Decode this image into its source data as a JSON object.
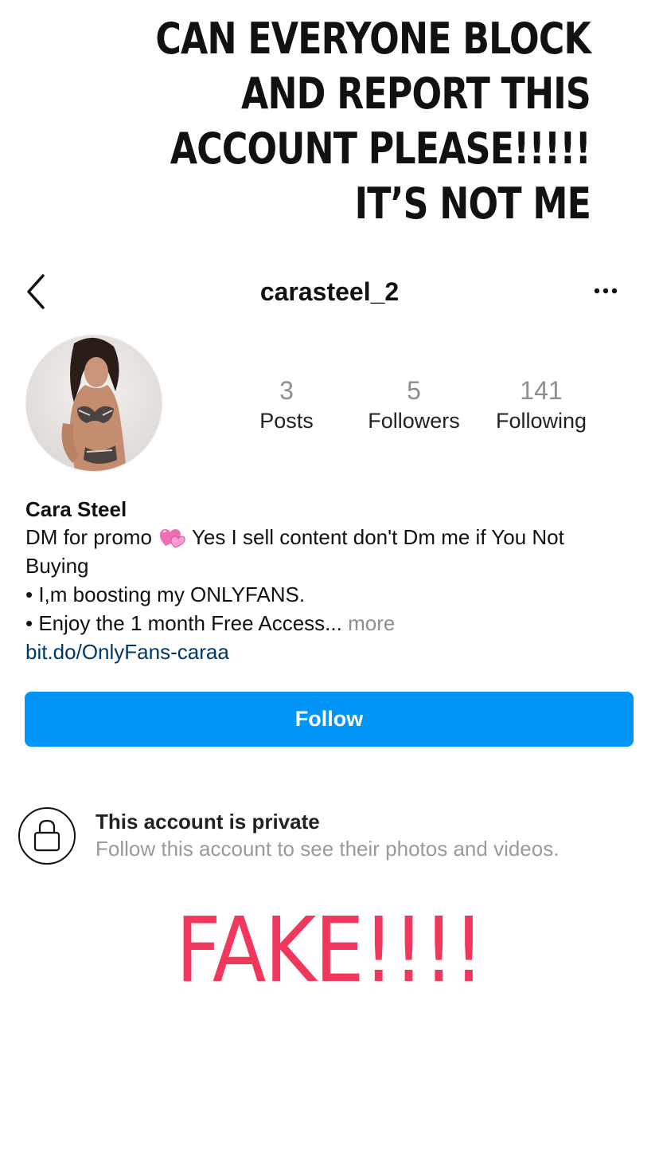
{
  "caption": {
    "lines": [
      "CAN  EVERYONE BLOCK",
      "AND REPORT THIS",
      "ACCOUNT PLEASE!!!!!",
      "IT’S NOT ME"
    ]
  },
  "header": {
    "username": "carasteel_2",
    "back_icon": "chevron-left-icon",
    "more_icon": "ellipsis-icon"
  },
  "profile": {
    "stats": [
      {
        "value": "3",
        "label": "Posts"
      },
      {
        "value": "5",
        "label": "Followers"
      },
      {
        "value": "141",
        "label": "Following"
      }
    ],
    "name": "Cara Steel",
    "bio": {
      "line1_before_emoji": "DM for promo ",
      "line1_after_emoji": "Yes I sell content don't Dm me if You Not",
      "line2": "Buying",
      "line3": "• I,m boosting my ONLYFANS.",
      "line4": "• Enjoy the 1 month Free Access...",
      "more": " more",
      "link": "bit.do/OnlyFans-caraa"
    },
    "follow_label": "Follow"
  },
  "private_notice": {
    "title": "This account is private",
    "subtitle": "Follow this account to see their photos and videos."
  },
  "stamp": "FAKE!!!!",
  "colors": {
    "follow_button": "#0095f6",
    "link": "#00376b",
    "stamp": "#f1385c",
    "muted": "#8e8e8e"
  }
}
